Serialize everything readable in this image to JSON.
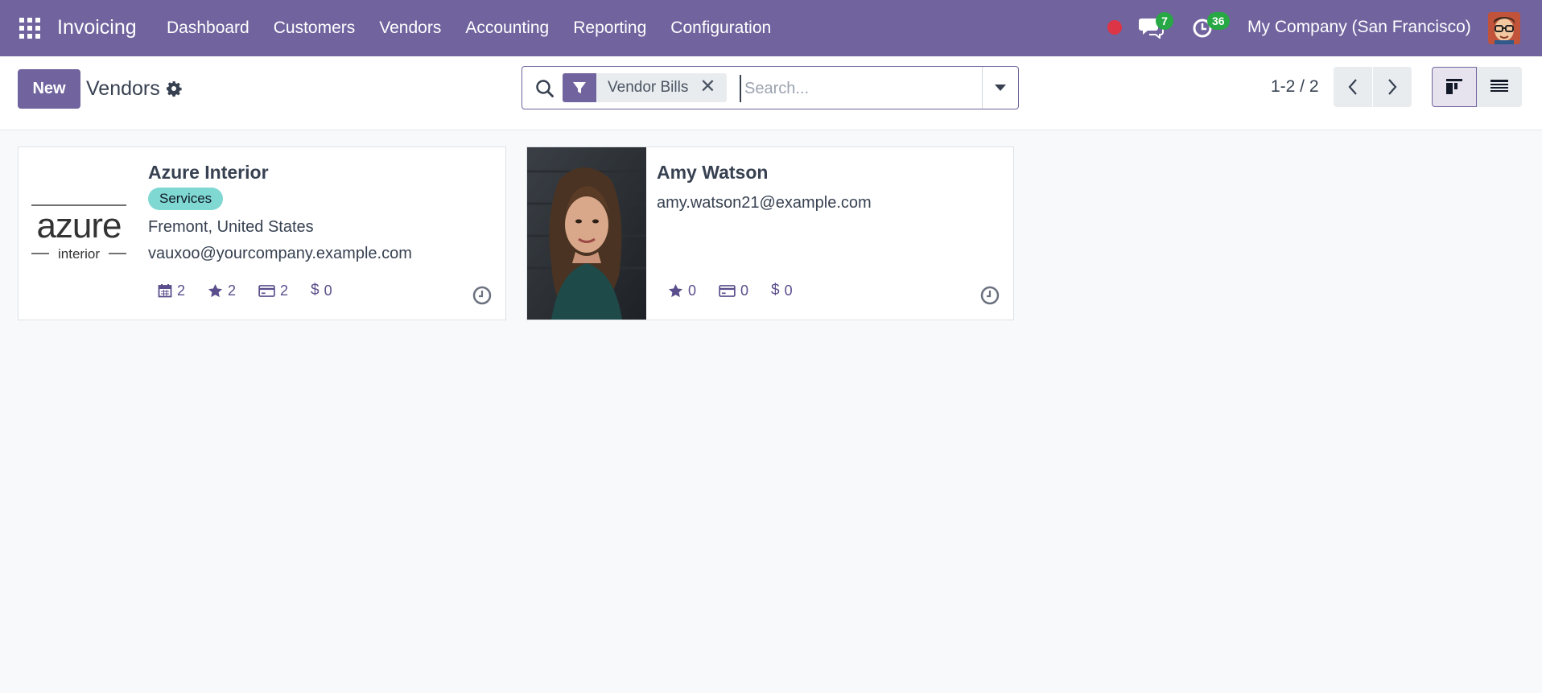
{
  "navbar": {
    "app_name": "Invoicing",
    "menu": [
      "Dashboard",
      "Customers",
      "Vendors",
      "Accounting",
      "Reporting",
      "Configuration"
    ],
    "messages_count": "7",
    "activities_count": "36",
    "company": "My Company (San Francisco)"
  },
  "control": {
    "new_label": "New",
    "title": "Vendors",
    "facet_label": "Vendor Bills",
    "search_placeholder": "Search...",
    "pager": "1-2 / 2"
  },
  "cards": [
    {
      "name": "Azure Interior",
      "logo_main": "azure",
      "logo_sub": "interior",
      "tag": "Services",
      "location": "Fremont, United States",
      "email": "vauxoo@yourcompany.example.com",
      "stats": {
        "meetings": "2",
        "favorites": "2",
        "bills": "2",
        "amount": "0"
      }
    },
    {
      "name": "Amy Watson",
      "email": "amy.watson21@example.com",
      "stats": {
        "favorites": "0",
        "bills": "0",
        "amount": "0"
      }
    }
  ],
  "colors": {
    "brand": "#71639e",
    "tag": "#7fd8d2",
    "badge": "#28a745",
    "recording": "#dc3545"
  }
}
